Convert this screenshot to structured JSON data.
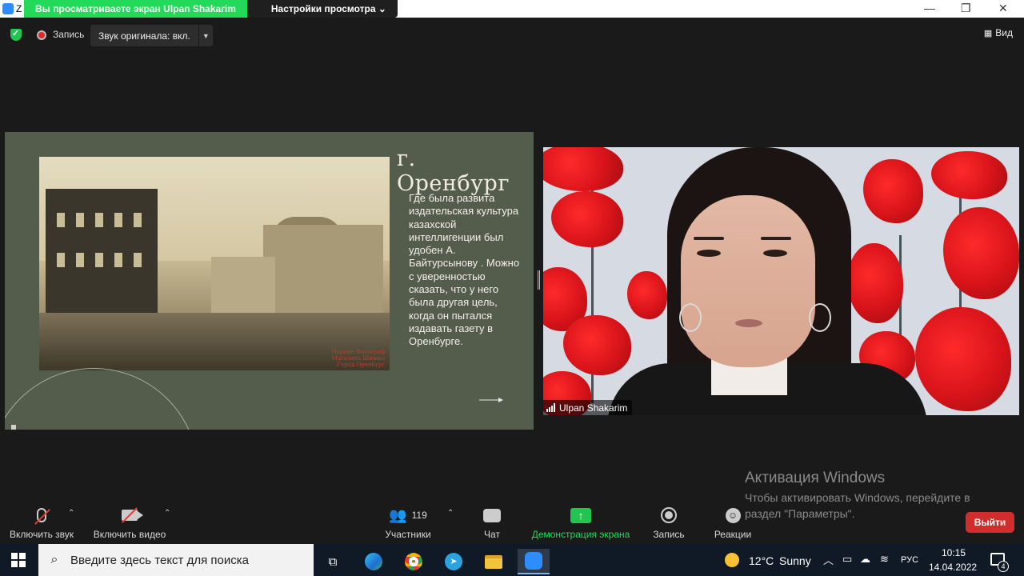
{
  "window": {
    "app_letter": "Z",
    "share_banner": "Вы просматриваете экран Ulpan Shakarim",
    "view_settings": "Настройки просмотра ⌄",
    "controls": [
      "—",
      "❐",
      "✕"
    ]
  },
  "topbar": {
    "record_label": "Запись",
    "original_sound": "Звук оригинала: вкл.",
    "view_label": "Вид"
  },
  "slide": {
    "title": "г. Оренбург",
    "body": "Где была развита издательская культура казахской интеллигенции был удобен А. Байтурсынову . Можно с уверенностью сказать, что у него была другая цель, когда он пытался издавать газету в Оренбурге.",
    "photo_caption": [
      "Нарине Фотограф",
      "Магазина Шишко",
      "Город Оренбург"
    ]
  },
  "video": {
    "participant_name": "Ulpan Shakarim"
  },
  "watermark": {
    "title": "Активация Windows",
    "subtitle": "Чтобы активировать Windows, перейдите в раздел \"Параметры\"."
  },
  "toolbar": {
    "unmute": "Включить звук",
    "start_video": "Включить видео",
    "participants": "Участники",
    "participant_count": "119",
    "chat": "Чат",
    "share_screen": "Демонстрация экрана",
    "record": "Запись",
    "reactions": "Реакции",
    "leave": "Выйти"
  },
  "taskbar": {
    "search_placeholder": "Введите здесь текст для поиска",
    "weather_temp": "12°C",
    "weather_desc": "Sunny",
    "language": "РУС",
    "time": "10:15",
    "date": "14.04.2022",
    "notifications": "4"
  },
  "colors": {
    "accent_green": "#23d959",
    "leave_red": "#d12d2d",
    "slide_bg": "#545c4b"
  }
}
